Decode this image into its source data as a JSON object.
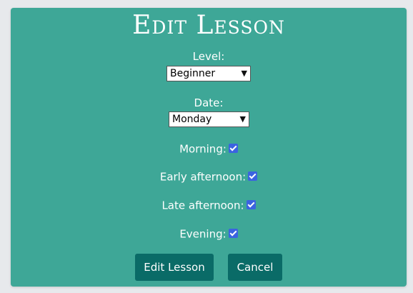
{
  "form": {
    "title": "Edit Lesson",
    "level": {
      "label": "Level:",
      "value": "Beginner"
    },
    "date": {
      "label": "Date:",
      "value": "Monday"
    },
    "slots": [
      {
        "label": "Morning:",
        "checked": true
      },
      {
        "label": "Early afternoon:",
        "checked": true
      },
      {
        "label": "Late afternoon:",
        "checked": true
      },
      {
        "label": "Evening:",
        "checked": true
      }
    ],
    "buttons": {
      "submit": "Edit Lesson",
      "cancel": "Cancel"
    }
  },
  "colors": {
    "card": "#3ea797",
    "button": "#0a6b67",
    "checkbox": "#3b63e0"
  }
}
